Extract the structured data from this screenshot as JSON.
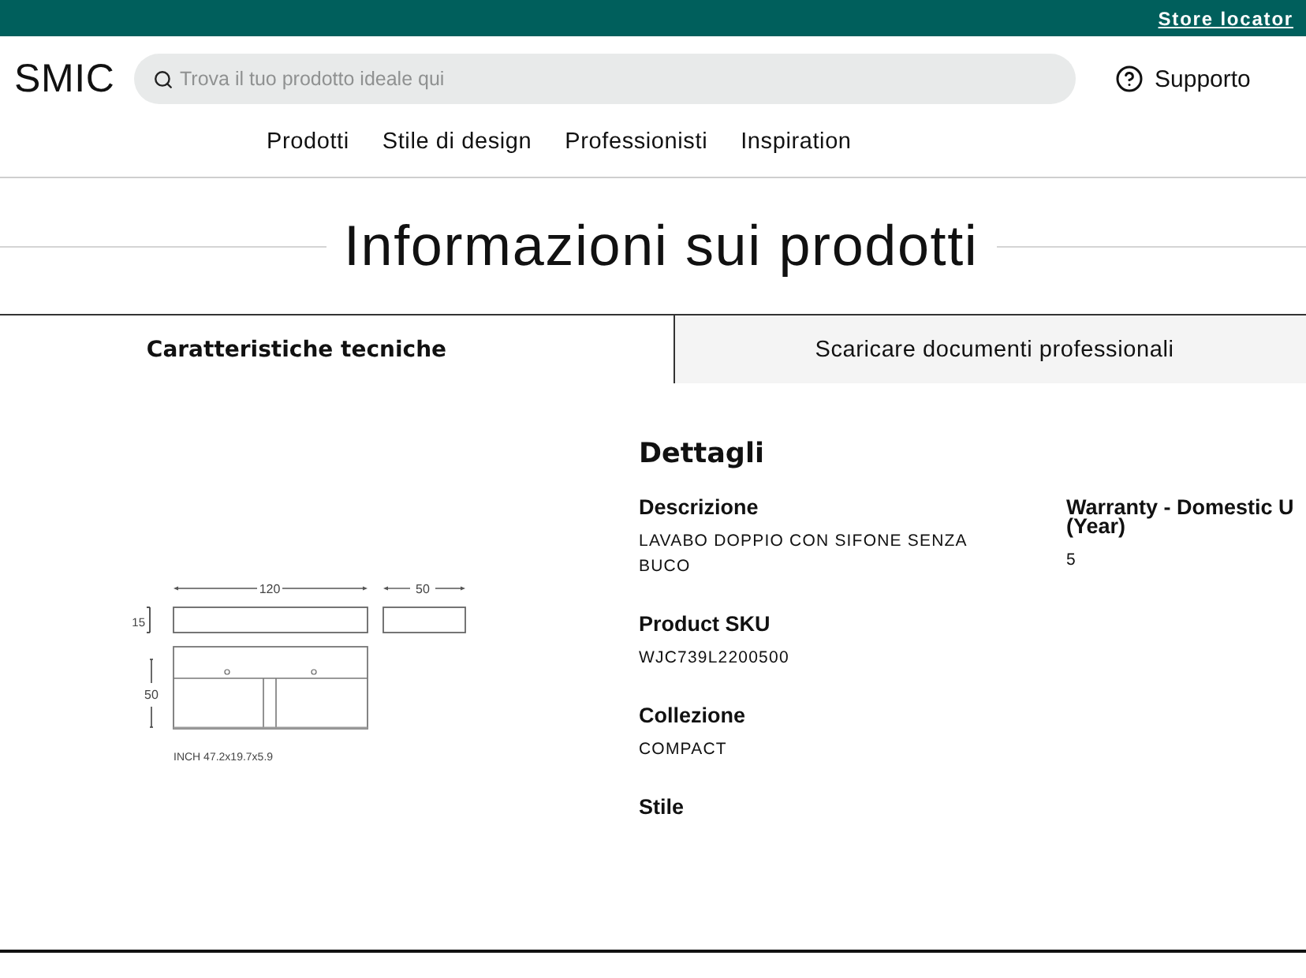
{
  "top_bar": {
    "link": "Store locator"
  },
  "header": {
    "logo": "SMIC",
    "search": {
      "placeholder": "Trova il tuo prodotto ideale qui"
    },
    "support": "Supporto"
  },
  "nav": [
    "Prodotti",
    "Stile di design",
    "Professionisti",
    "Inspiration"
  ],
  "page_title": "Informazioni sui prodotti",
  "tabs": [
    {
      "label": "Caratteristiche tecniche",
      "selected": true
    },
    {
      "label": "Scaricare documenti professionali",
      "selected": false
    }
  ],
  "drawing": {
    "width_label": "120",
    "depth_label": "50",
    "thickness_label": "15",
    "height_label": "50",
    "caption": "INCH 47.2x19.7x5.9"
  },
  "details": {
    "title": "Dettagli",
    "columns": [
      [
        {
          "label": "Descrizione",
          "value": "LAVABO DOPPIO CON SIFONE SENZA BUCO"
        },
        {
          "label": "Product SKU",
          "value": "WJC739L2200500"
        },
        {
          "label": "Collezione",
          "value": "COMPACT"
        },
        {
          "label": "Stile"
        }
      ],
      [
        {
          "label": "Warranty - Domestic U\n(Year)",
          "value": "5"
        }
      ]
    ]
  }
}
